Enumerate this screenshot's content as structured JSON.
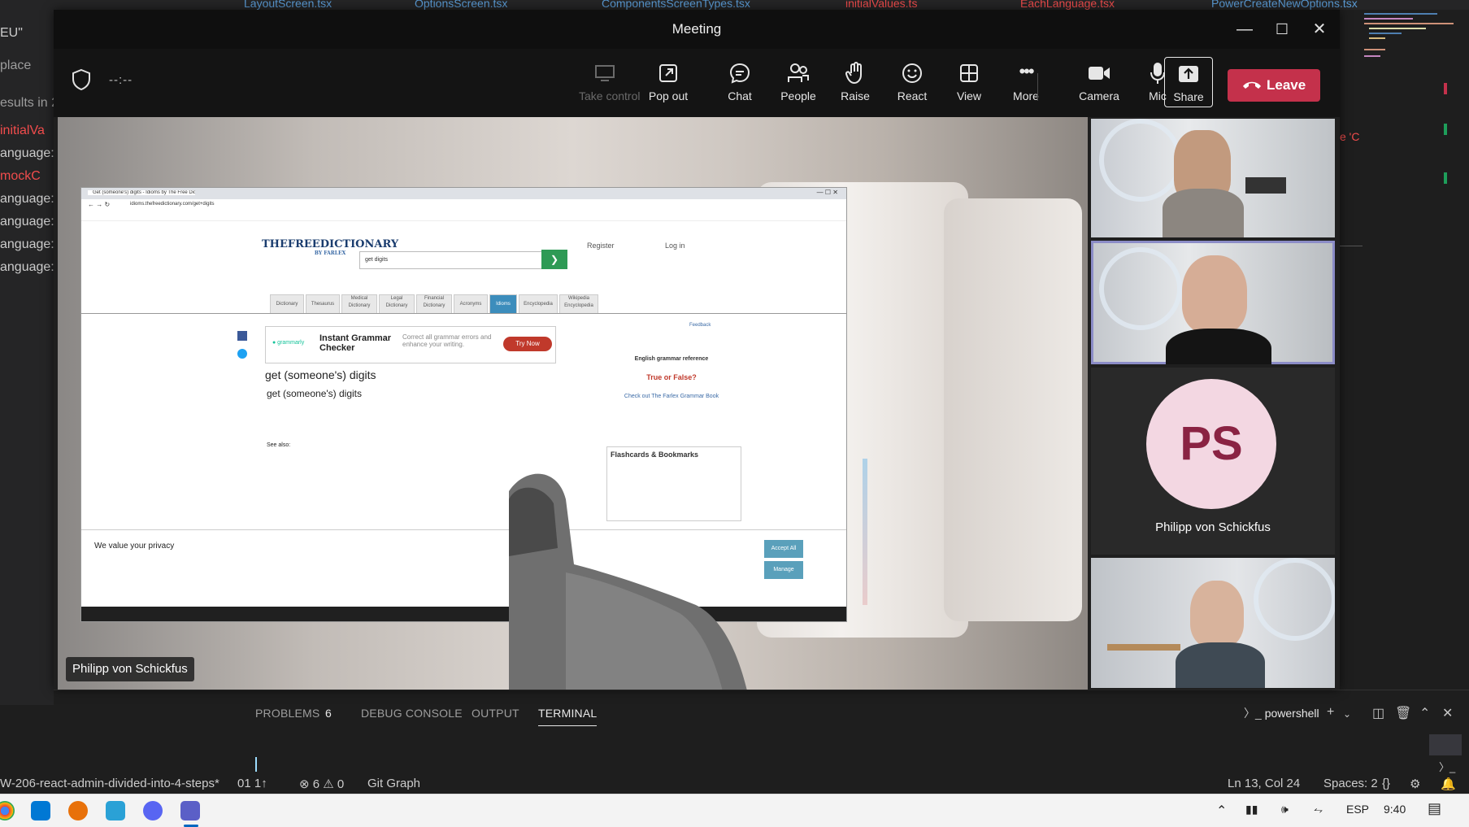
{
  "ide": {
    "tabs": [
      "LayoutScreen.tsx",
      "OptionsScreen.tsx",
      "ComponentsScreenTypes.tsx",
      "initialValues.ts",
      "EachLanguage.tsx",
      "PowerCreateNewOptions.tsx"
    ],
    "left_lines": [
      "EU\"",
      "place",
      "esults in 2",
      "initialVa",
      "anguage:",
      "mockC",
      "anguage:",
      "anguage:",
      "anguage:",
      "anguage:"
    ],
    "panel_tabs": {
      "problems": "PROBLEMS",
      "problems_count": "6",
      "debug": "DEBUG CONSOLE",
      "output": "OUTPUT",
      "terminal": "TERMINAL"
    },
    "terminal_profile": "powershell",
    "status": {
      "branch": "W-206-react-admin-divided-into-4-steps*",
      "sync": "01 1↑",
      "problems": "⊗ 6 ⚠ 0",
      "git_graph": "Git Graph",
      "position": "Ln 13, Col 24",
      "spaces": "Spaces: 2",
      "braces": "{}"
    }
  },
  "taskbar": {
    "lang": "ESP",
    "time": "9:40"
  },
  "meeting": {
    "title": "Meeting",
    "timer": "--:--",
    "buttons": {
      "take_control": "Take control",
      "pop_out": "Pop out",
      "chat": "Chat",
      "people": "People",
      "raise": "Raise",
      "react": "React",
      "view": "View",
      "more": "More",
      "camera": "Camera",
      "mic": "Mic",
      "share": "Share",
      "leave": "Leave"
    },
    "presenter_name": "Philipp von Schickfus",
    "participants": [
      {
        "initials": "PS",
        "name": "Philipp von Schickfus"
      }
    ]
  },
  "shared_screen": {
    "tab_title": "Get (someone's) digits - Idioms by The Free Dictionary",
    "url": "idioms.thefreedictionary.com/get+digits",
    "logo": "THEFREEDICTIONARY",
    "logo_sub": "BY FARLEX",
    "search_value": "get digits",
    "register": "Register",
    "login": "Log in",
    "nav": [
      "Dictionary",
      "Thesaurus",
      "Medical Dictionary",
      "Legal Dictionary",
      "Financial Dictionary",
      "Acronyms",
      "Idioms",
      "Encyclopedia",
      "Wikipedia Encyclopedia"
    ],
    "ad_title": "Instant Grammar Checker",
    "ad_desc": "Correct all grammar errors and enhance your writing.",
    "ad_button": "Try Now",
    "phrase_title": "get (someone's) digits",
    "phrase_sub": "get (someone's) digits",
    "see_also": "See also:",
    "grammar_ref": "English grammar reference",
    "true_false": "True or False?",
    "grammar_link": "Check out The Farlex Grammar Book",
    "flashcards": "Flashcards & Bookmarks",
    "feedback": "Feedback",
    "privacy_title": "We value your privacy",
    "accept": "Accept All",
    "manage": "Manage"
  }
}
